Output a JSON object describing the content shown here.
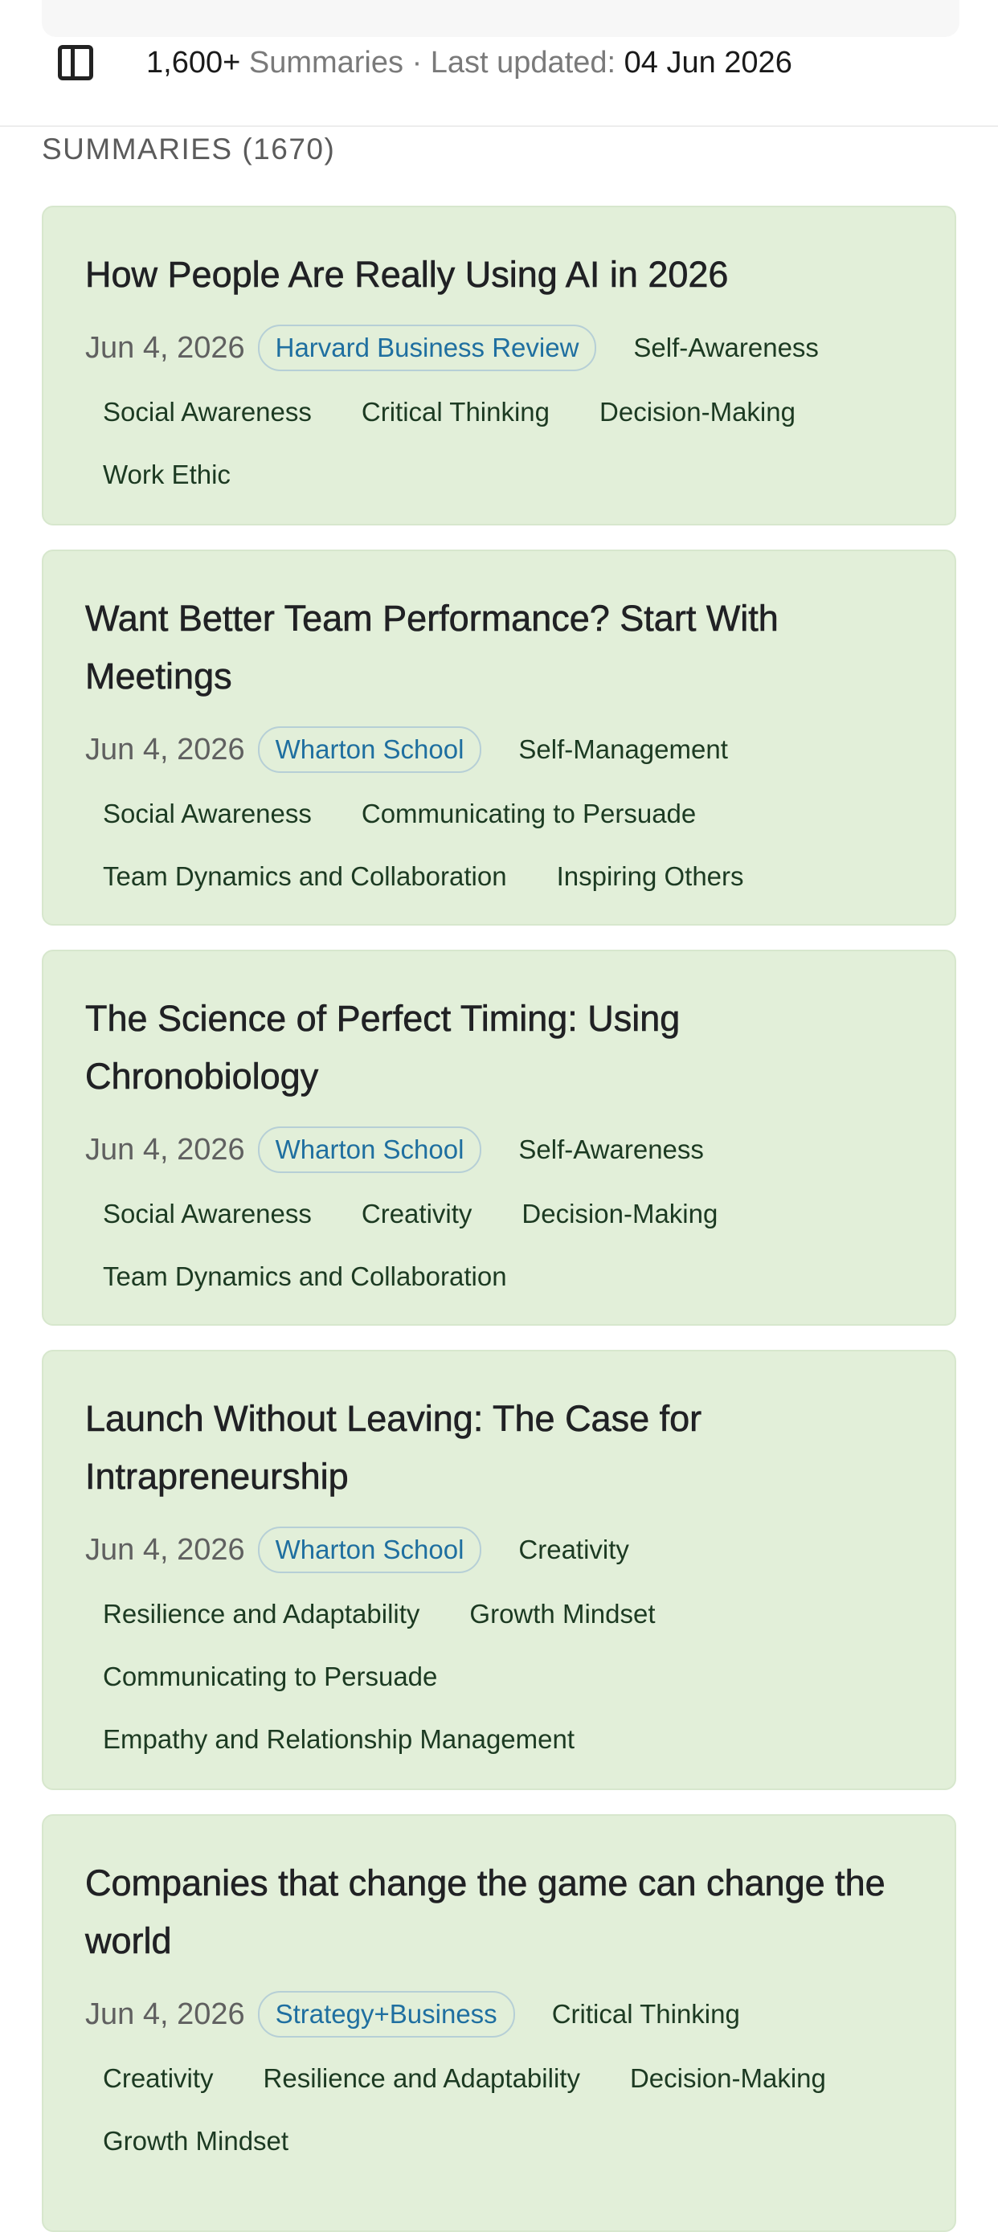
{
  "header": {
    "count": "1,600+",
    "summaries_label": " Summaries · Last updated: ",
    "updated_date": "04 Jun 2026"
  },
  "section": {
    "title": "SUMMARIES (1670)"
  },
  "cards": [
    {
      "title": "How People Are Really Using AI in 2026",
      "date": "Jun 4, 2026",
      "source": "Harvard Business Review",
      "tags": [
        "Self-Awareness",
        "Social Awareness",
        "Critical Thinking",
        "Decision-Making",
        "Work Ethic"
      ]
    },
    {
      "title": "Want Better Team Performance? Start With Meetings",
      "date": "Jun 4, 2026",
      "source": "Wharton School",
      "tags": [
        "Self-Management",
        "Social Awareness",
        "Communicating to Persuade",
        "Team Dynamics and Collaboration",
        "Inspiring Others"
      ]
    },
    {
      "title": "The Science of Perfect Timing: Using Chronobiology",
      "date": "Jun 4, 2026",
      "source": "Wharton School",
      "tags": [
        "Self-Awareness",
        "Social Awareness",
        "Creativity",
        "Decision-Making",
        "Team Dynamics and Collaboration"
      ]
    },
    {
      "title": "Launch Without Leaving: The Case for Intrapreneurship",
      "date": "Jun 4, 2026",
      "source": "Wharton School",
      "tags": [
        "Creativity",
        "Resilience and Adaptability",
        "Growth Mindset",
        "Communicating to Persuade",
        "Empathy and Relationship Management"
      ]
    },
    {
      "title": "Companies that change the game can change the world",
      "date": "Jun 4, 2026",
      "source": "Strategy+Business",
      "tags": [
        "Critical Thinking",
        "Creativity",
        "Resilience and Adaptability",
        "Decision-Making",
        "Growth Mindset"
      ]
    }
  ]
}
